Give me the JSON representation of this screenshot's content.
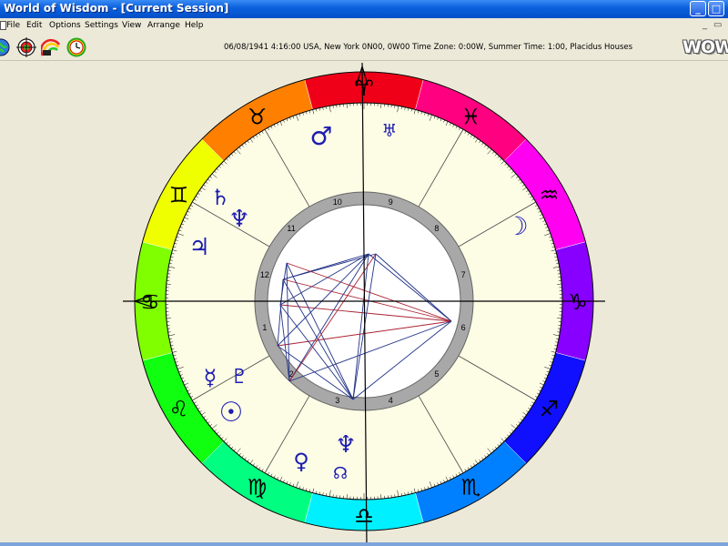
{
  "window": {
    "title": "World of Wisdom - [Current Session]",
    "minimize_label": "_",
    "maximize_label": "□",
    "close_label": "×"
  },
  "menu": {
    "items": [
      "File",
      "Edit",
      "Options",
      "Settings",
      "View",
      "Arrange",
      "Help"
    ],
    "mdi_minimize": "_",
    "mdi_restore": "▭",
    "mdi_close": "×"
  },
  "toolbar": {
    "icons": [
      "globe-icon",
      "target-icon",
      "rainbow-icon",
      "clock-icon"
    ],
    "info_text": "06/08/1941 4:16:00 USA, New York 0N00, 0W00 Time Zone: 0:00W, Summer Time: 1:00, Placidus Houses",
    "logo_text": "WOW"
  },
  "zodiac": {
    "signs": [
      {
        "name": "Aries",
        "glyph": "♈︎",
        "color": "#f00018"
      },
      {
        "name": "Pisces",
        "glyph": "♓︎",
        "color": "#ff0080"
      },
      {
        "name": "Aquarius",
        "glyph": "♒︎",
        "color": "#ff00f0"
      },
      {
        "name": "Capricorn",
        "glyph": "♑︎",
        "color": "#8800ff"
      },
      {
        "name": "Sagittarius",
        "glyph": "♐︎",
        "color": "#1010ff"
      },
      {
        "name": "Scorpio",
        "glyph": "♏︎",
        "color": "#0080ff"
      },
      {
        "name": "Libra",
        "glyph": "♎︎",
        "color": "#00f0ff"
      },
      {
        "name": "Virgo",
        "glyph": "♍︎",
        "color": "#00ff80"
      },
      {
        "name": "Leo",
        "glyph": "♌︎",
        "color": "#10ff10"
      },
      {
        "name": "Cancer",
        "glyph": "♋︎",
        "color": "#80ff00"
      },
      {
        "name": "Gemini",
        "glyph": "♊︎",
        "color": "#f0ff00"
      },
      {
        "name": "Taurus",
        "glyph": "♉︎",
        "color": "#ff8000"
      }
    ]
  },
  "houses": {
    "numbers": [
      "1",
      "2",
      "3",
      "4",
      "5",
      "6",
      "7",
      "8",
      "9",
      "10",
      "11",
      "12"
    ]
  },
  "planets": [
    {
      "name": "Mars",
      "glyph": "♂︎"
    },
    {
      "name": "Uranus",
      "glyph": "♅︎"
    },
    {
      "name": "Saturn",
      "glyph": "♄︎"
    },
    {
      "name": "Neptune",
      "glyph": "♆︎"
    },
    {
      "name": "Jupiter",
      "glyph": "♃︎"
    },
    {
      "name": "Moon",
      "glyph": "☽︎"
    },
    {
      "name": "Pluto",
      "glyph": "♇︎"
    },
    {
      "name": "Mercury",
      "glyph": "☿︎"
    },
    {
      "name": "Sun",
      "glyph": "☉︎"
    },
    {
      "name": "Venus",
      "glyph": "♀︎"
    },
    {
      "name": "Neptune-2",
      "glyph": "♆︎"
    },
    {
      "name": "North Node",
      "glyph": "☊︎"
    }
  ],
  "colors": {
    "titlebar": "#0a5fdc",
    "wheel_fill": "#fdfde6",
    "house_ring": "#a8a8a8",
    "glyph": "#1d1db0"
  }
}
